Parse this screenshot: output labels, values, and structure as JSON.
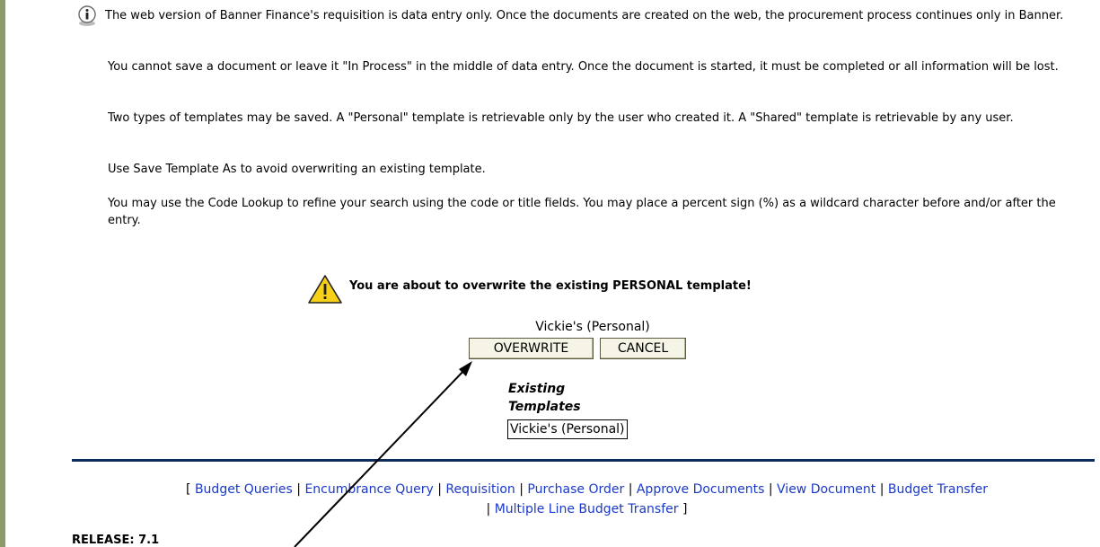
{
  "info": {
    "icon": "info-icon",
    "paragraphs": [
      "The web version of Banner Finance's requisition is data entry only. Once the documents are created on the web, the procurement process continues only in Banner.",
      "You cannot save a document or leave it \"In Process\" in the middle of data entry. Once the document is started, it must be completed or all information will be lost.",
      "Two types of templates may be saved. A \"Personal\" template is retrievable only by the user who created it. A \"Shared\" template is retrievable by any user.",
      "Use Save Template As to avoid overwriting an existing template.",
      "You may use the Code Lookup to refine your search using the code or title fields. You may place a percent sign (%) as a wildcard character before and/or after the entry."
    ]
  },
  "warning": {
    "icon": "warning-triangle-icon",
    "message": "You are about to overwrite the existing PERSONAL template!"
  },
  "template": {
    "name": "Vickie's (Personal)",
    "overwrite_label": "OVERWRITE",
    "cancel_label": "CANCEL"
  },
  "existing": {
    "label": "Existing Templates",
    "selected": "Vickie's (Personal)"
  },
  "nav": {
    "open": "[",
    "close": "]",
    "separator": "|",
    "links": [
      "Budget Queries",
      "Encumbrance Query",
      "Requisition",
      "Purchase Order",
      "Approve Documents",
      "View Document",
      "Budget Transfer",
      "Multiple Line Budget Transfer"
    ]
  },
  "footer": {
    "release": "RELEASE: 7.1"
  },
  "colors": {
    "left_bar": "#8c9a6a",
    "rule": "#0e2a5c",
    "link": "#1a39c8",
    "button_bg": "#f6f4e6"
  }
}
